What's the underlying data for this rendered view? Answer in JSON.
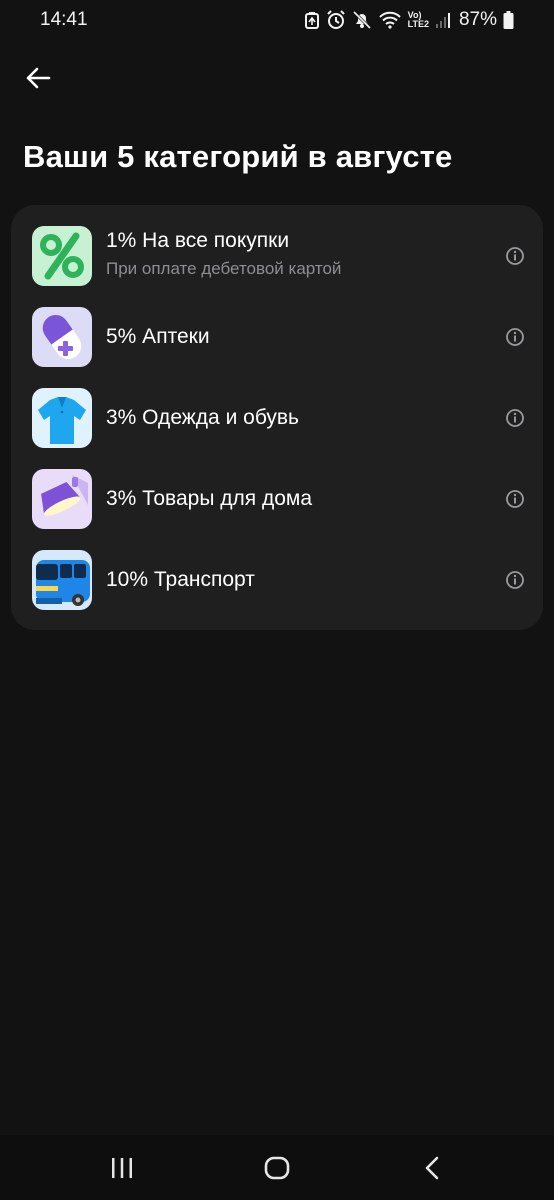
{
  "status_bar": {
    "time": "14:41",
    "battery_percent": "87%",
    "icons": [
      "data-saver-icon",
      "alarm-icon",
      "mute-icon",
      "wifi-icon",
      "volte-lte2-icon",
      "signal-icon",
      "battery-icon"
    ],
    "volte_label": "Vo)",
    "lte_label": "LTE2"
  },
  "header": {
    "back_icon": "arrow-left-icon",
    "title": "Ваши 5 категорий в августе"
  },
  "categories": [
    {
      "title": "1% На все покупки",
      "subtitle": "При оплате дебетовой картой",
      "icon": "percent-icon",
      "icon_bg": "#c8f0d2"
    },
    {
      "title": "5% Аптеки",
      "subtitle": "",
      "icon": "pill-icon",
      "icon_bg": "#dcdcf6"
    },
    {
      "title": "3% Одежда и обувь",
      "subtitle": "",
      "icon": "tshirt-icon",
      "icon_bg": "#dff2fd"
    },
    {
      "title": "3% Товары для дома",
      "subtitle": "",
      "icon": "lamp-icon",
      "icon_bg": "#e8dcf8"
    },
    {
      "title": "10% Транспорт",
      "subtitle": "",
      "icon": "bus-icon",
      "icon_bg": "#d6e8fb"
    }
  ],
  "nav_bar": {
    "recents_icon": "recents-icon",
    "home_icon": "home-icon",
    "back_icon": "chevron-left-icon"
  },
  "colors": {
    "background": "#121212",
    "card": "#1f1f1f",
    "text_primary": "#ffffff",
    "text_secondary": "#8e8e93"
  }
}
